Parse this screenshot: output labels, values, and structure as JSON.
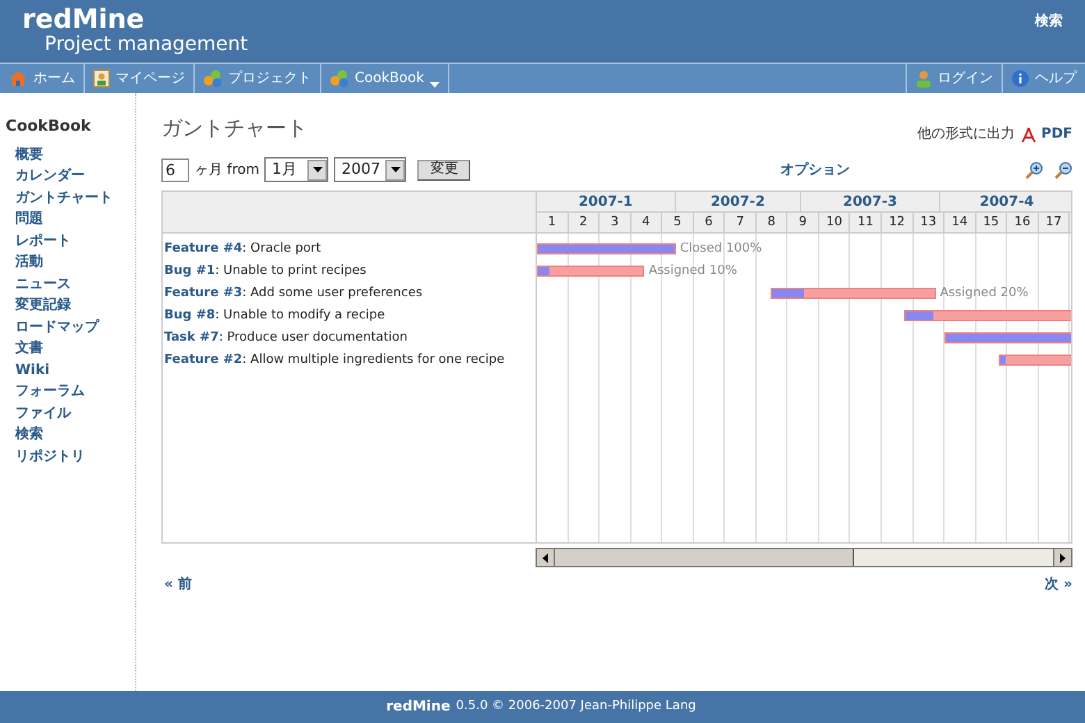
{
  "header": {
    "logo": "redMine",
    "subtitle": "Project management",
    "search_link": "検索"
  },
  "nav": {
    "left": [
      {
        "label": "ホーム",
        "kind": "home"
      },
      {
        "label": "マイページ",
        "kind": "page"
      },
      {
        "label": "プロジェクト",
        "kind": "project"
      },
      {
        "label": "CookBook",
        "kind": "project",
        "dropdown": true
      }
    ],
    "right": [
      {
        "label": "ログイン",
        "kind": "login"
      },
      {
        "label": "ヘルプ",
        "kind": "help"
      }
    ]
  },
  "sidebar": {
    "title": "CookBook",
    "items": [
      "概要",
      "カレンダー",
      "ガントチャート",
      "問題",
      "レポート",
      "活動",
      "ニュース",
      "変更記録",
      "ロードマップ",
      "文書",
      "Wiki",
      "フォーラム",
      "ファイル",
      "検索",
      "リポジトリ"
    ]
  },
  "page": {
    "title": "ガントチャート",
    "export_label": "他の形式に出力",
    "export_pdf": "PDF"
  },
  "controls": {
    "months": "6",
    "months_label": "ヶ月 from",
    "month": "1月",
    "year": "2007",
    "apply": "変更",
    "options": "オプション"
  },
  "gantt": {
    "months": [
      "2007-1",
      "2007-2",
      "2007-3",
      "2007-4"
    ],
    "weeks": [
      "1",
      "2",
      "3",
      "4",
      "5",
      "6",
      "7",
      "8",
      "9",
      "10",
      "11",
      "12",
      "13",
      "14",
      "15",
      "16",
      "17"
    ],
    "tasks": [
      {
        "ref": "Feature #4",
        "subject": ": Oracle port",
        "level": 1.0,
        "status": "Closed 100%"
      },
      {
        "ref": "Bug #1",
        "subject": ": Unable to print recipes",
        "level": 0.1,
        "status": "Assigned 10%"
      },
      {
        "ref": "Feature #3",
        "subject": ": Add some user preferences",
        "level": 0.2,
        "status": "Assigned 20%"
      },
      {
        "ref": "Bug #8",
        "subject": ": Unable to modify a recipe",
        "level": 0.13
      },
      {
        "ref": "Task #7",
        "subject": ": Produce user documentation",
        "level": 1.0
      },
      {
        "ref": "Feature #2",
        "subject": ": Allow multiple ingredients for one recipe",
        "level": 0.05
      }
    ]
  },
  "pager": {
    "prev": "« 前",
    "next": "次 »"
  },
  "footer": {
    "brand": "redMine",
    "text": "0.5.0 © 2006-2007 Jean-Philippe Lang"
  }
}
